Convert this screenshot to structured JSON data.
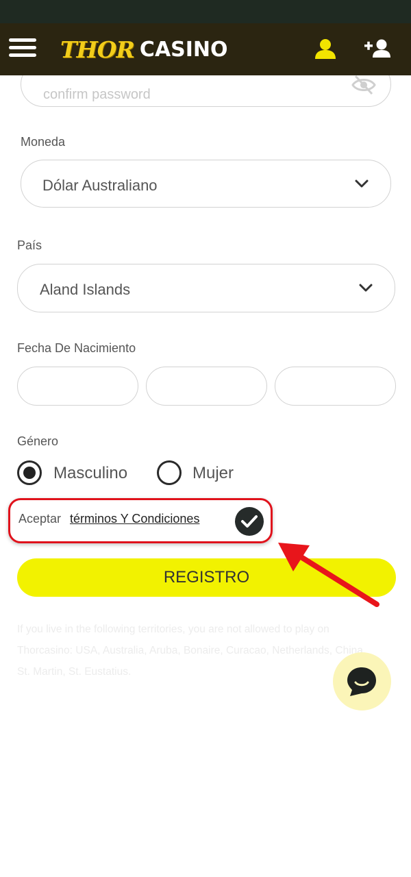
{
  "header": {
    "logo_thor": "THOR",
    "logo_casino": "CASINO",
    "menu_icon": "hamburger-menu-icon",
    "user_icon": "user-icon",
    "add_user_icon": "add-user-icon",
    "accent_color": "#f2cd1a"
  },
  "form": {
    "confirm_password": {
      "placeholder": "confirm password",
      "icon": "eye-off-icon"
    },
    "currency": {
      "label": "Moneda",
      "value": "Dólar Australiano"
    },
    "country": {
      "label": "País",
      "value": "Aland Islands"
    },
    "birth_date": {
      "label": "Fecha De Nacimiento"
    },
    "gender": {
      "label": "Género",
      "options": [
        {
          "label": "Masculino",
          "selected": true
        },
        {
          "label": "Mujer",
          "selected": false
        }
      ]
    },
    "terms": {
      "prefix": "Aceptar",
      "link": "términos Y Condiciones",
      "checked": true
    },
    "submit_label": "REGISTRO"
  },
  "notice": "If you live in the following territories, you are not allowed to play on Thorcasino: USA, Australia, Aruba, Bonaire, Curacao, Netherlands, China, St. Martin, St. Eustatius.",
  "colors": {
    "header_bg": "#2b2511",
    "status_bar": "#1f2a22",
    "button_yellow": "#f2f200",
    "highlight_red": "#e0121c",
    "chat_bg": "#fbf5b8"
  }
}
